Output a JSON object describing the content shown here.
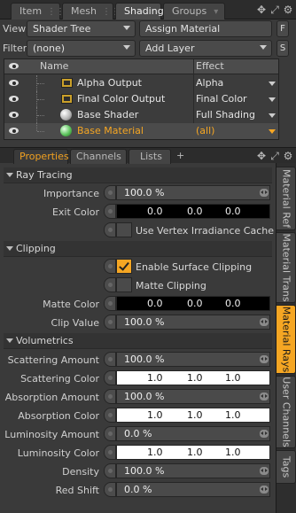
{
  "top_tabs": [
    {
      "label": "Item",
      "active": false
    },
    {
      "label": "Mesh",
      "active": false
    },
    {
      "label": "Shading",
      "active": true
    },
    {
      "label": "Groups",
      "active": false
    }
  ],
  "view_row": {
    "label": "View",
    "view_value": "Shader Tree",
    "assign_button": "Assign Material",
    "side_button": "F"
  },
  "filter_row": {
    "label": "Filter",
    "filter_value": "(none)",
    "add_layer": "Add Layer",
    "side_button": "S"
  },
  "tree": {
    "columns": {
      "name": "Name",
      "effect": "Effect"
    },
    "rows": [
      {
        "name": "Alpha Output",
        "effect": "Alpha",
        "icon": "image-icon"
      },
      {
        "name": "Final Color Output",
        "effect": "Final Color",
        "icon": "image-icon"
      },
      {
        "name": "Base Shader",
        "effect": "Full Shading",
        "icon": "shader-ball-icon"
      },
      {
        "name": "Base Material",
        "effect": "(all)",
        "icon": "material-ball-icon",
        "selected": true
      }
    ]
  },
  "prop_tabs": [
    {
      "label": "Properties",
      "active": true
    },
    {
      "label": "Channels",
      "active": false
    },
    {
      "label": "Lists",
      "active": false
    },
    {
      "label": "+",
      "active": false
    }
  ],
  "side_tabs": [
    {
      "label": "Material Ref",
      "active": false
    },
    {
      "label": "Material Trans",
      "active": false
    },
    {
      "label": "Material Rays",
      "active": true
    },
    {
      "label": "User Channels",
      "active": false
    },
    {
      "label": "Tags",
      "active": false
    }
  ],
  "sections": {
    "ray_tracing": "Ray Tracing",
    "clipping": "Clipping",
    "volumetrics": "Volumetrics"
  },
  "props": {
    "importance": {
      "label": "Importance",
      "value": "100.0 %"
    },
    "exit_color": {
      "label": "Exit Color",
      "r": "0.0",
      "g": "0.0",
      "b": "0.0"
    },
    "vertex_irradiance": {
      "label": "Use Vertex Irradiance Cache",
      "checked": false
    },
    "enable_clipping": {
      "label": "Enable Surface Clipping",
      "checked": true
    },
    "matte_clipping": {
      "label": "Matte Clipping",
      "checked": false
    },
    "matte_color": {
      "label": "Matte Color",
      "r": "0.0",
      "g": "0.0",
      "b": "0.0"
    },
    "clip_value": {
      "label": "Clip Value",
      "value": "100.0 %"
    },
    "scattering_amount": {
      "label": "Scattering Amount",
      "value": "100.0 %"
    },
    "scattering_color": {
      "label": "Scattering Color",
      "r": "1.0",
      "g": "1.0",
      "b": "1.0"
    },
    "absorption_amount": {
      "label": "Absorption Amount",
      "value": "100.0 %"
    },
    "absorption_color": {
      "label": "Absorption Color",
      "r": "1.0",
      "g": "1.0",
      "b": "1.0"
    },
    "luminosity_amount": {
      "label": "Luminosity Amount",
      "value": "0.0 %"
    },
    "luminosity_color": {
      "label": "Luminosity Color",
      "r": "1.0",
      "g": "1.0",
      "b": "1.0"
    },
    "density": {
      "label": "Density",
      "value": "100.0 %"
    },
    "red_shift": {
      "label": "Red Shift",
      "value": "0.0 %"
    }
  },
  "colors": {
    "accent": "#f5a623",
    "panel": "#3a3a3a",
    "dark": "#2c2c2c"
  }
}
